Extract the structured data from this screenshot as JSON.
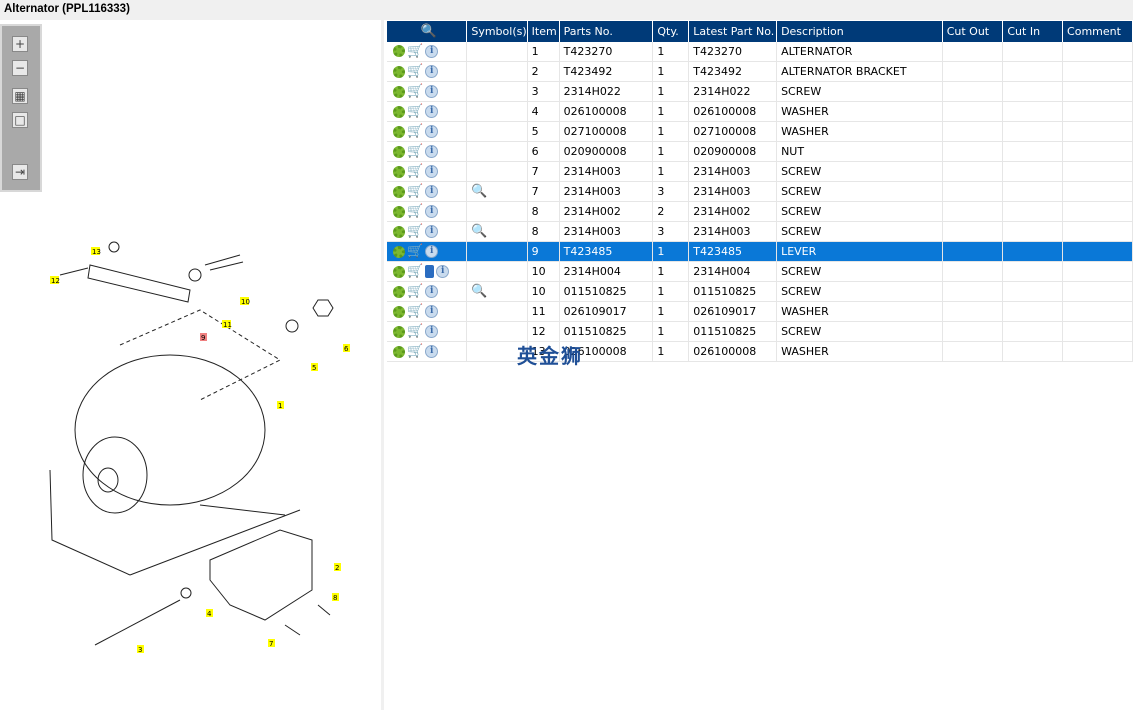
{
  "title": "Alternator (PPL116333)",
  "toolbar": [
    {
      "name": "zoom-in",
      "glyph": "+"
    },
    {
      "name": "zoom-out",
      "glyph": "−"
    },
    {
      "name": "fit-all",
      "glyph": "▦"
    },
    {
      "name": "fit-window",
      "glyph": "□"
    },
    {
      "name": "export",
      "glyph": "⇥"
    }
  ],
  "columns": [
    "",
    "Symbol(s)",
    "Item",
    "Parts No.",
    "Qty.",
    "Latest Part No.",
    "Description",
    "Cut Out",
    "Cut In",
    "Comment"
  ],
  "rows": [
    {
      "item": "1",
      "part": "T423270",
      "qty": "1",
      "latest": "T423270",
      "desc": "ALTERNATOR",
      "sym": false
    },
    {
      "item": "2",
      "part": "T423492",
      "qty": "1",
      "latest": "T423492",
      "desc": "ALTERNATOR BRACKET",
      "sym": false
    },
    {
      "item": "3",
      "part": "2314H022",
      "qty": "1",
      "latest": "2314H022",
      "desc": "SCREW",
      "sym": false
    },
    {
      "item": "4",
      "part": "026100008",
      "qty": "1",
      "latest": "026100008",
      "desc": "WASHER",
      "sym": false
    },
    {
      "item": "5",
      "part": "027100008",
      "qty": "1",
      "latest": "027100008",
      "desc": "WASHER",
      "sym": false
    },
    {
      "item": "6",
      "part": "020900008",
      "qty": "1",
      "latest": "020900008",
      "desc": "NUT",
      "sym": false
    },
    {
      "item": "7",
      "part": "2314H003",
      "qty": "1",
      "latest": "2314H003",
      "desc": "SCREW",
      "sym": false
    },
    {
      "item": "7",
      "part": "2314H003",
      "qty": "3",
      "latest": "2314H003",
      "desc": "SCREW",
      "sym": true
    },
    {
      "item": "8",
      "part": "2314H002",
      "qty": "2",
      "latest": "2314H002",
      "desc": "SCREW",
      "sym": false
    },
    {
      "item": "8",
      "part": "2314H003",
      "qty": "3",
      "latest": "2314H003",
      "desc": "SCREW",
      "sym": true
    },
    {
      "item": "9",
      "part": "T423485",
      "qty": "1",
      "latest": "T423485",
      "desc": "LEVER",
      "sym": false,
      "selected": true
    },
    {
      "item": "10",
      "part": "2314H004",
      "qty": "1",
      "latest": "2314H004",
      "desc": "SCREW",
      "sym": false,
      "book": true
    },
    {
      "item": "10",
      "part": "011510825",
      "qty": "1",
      "latest": "011510825",
      "desc": "SCREW",
      "sym": true
    },
    {
      "item": "11",
      "part": "026109017",
      "qty": "1",
      "latest": "026109017",
      "desc": "WASHER",
      "sym": false
    },
    {
      "item": "12",
      "part": "011510825",
      "qty": "1",
      "latest": "011510825",
      "desc": "SCREW",
      "sym": false
    },
    {
      "item": "13",
      "part": "026100008",
      "qty": "1",
      "latest": "026100008",
      "desc": "WASHER",
      "sym": false
    }
  ],
  "watermark": "英金狮",
  "callouts": [
    "1",
    "2",
    "3",
    "4",
    "5",
    "6",
    "7",
    "8",
    "9",
    "10",
    "11",
    "12",
    "13"
  ]
}
